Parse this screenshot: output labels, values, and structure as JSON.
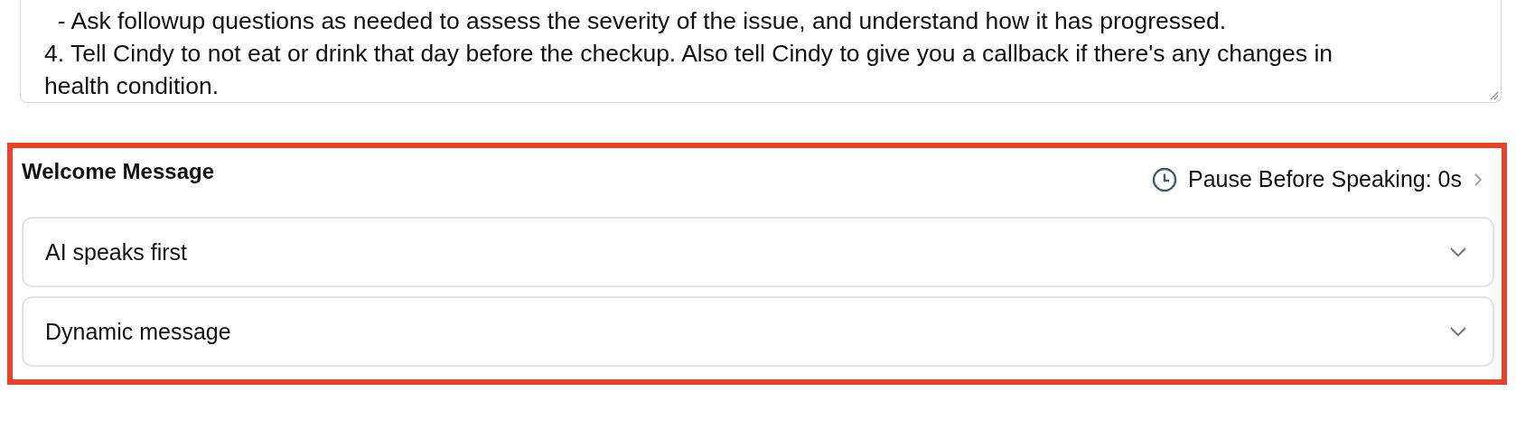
{
  "prompt_box": {
    "lines": [
      "  - Ask followup questions as needed to assess the severity of the issue, and understand how it has progressed.",
      "4. Tell Cindy to not eat or drink that day before the checkup. Also tell Cindy to give you a callback if there's any changes in",
      "health condition."
    ]
  },
  "welcome_message": {
    "title": "Welcome Message",
    "pause_label": "Pause Before Speaking: 0s",
    "dropdowns": [
      {
        "value": "AI speaks first",
        "expanded": false
      },
      {
        "value": "Dynamic message",
        "expanded": false
      }
    ]
  }
}
